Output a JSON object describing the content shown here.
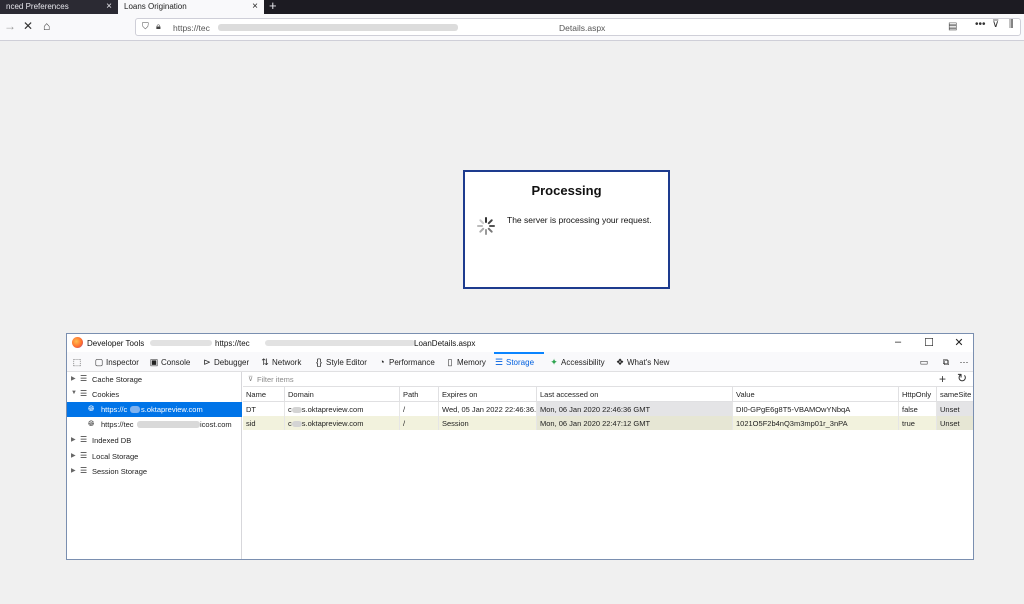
{
  "browser": {
    "tabs": [
      {
        "label": "nced Preferences"
      },
      {
        "label": "Loans Origination"
      }
    ],
    "url_prefix": "https://tec",
    "url_suffix": "Details.aspx"
  },
  "dialog": {
    "title": "Processing",
    "message": "The server is processing your request."
  },
  "devtools": {
    "window_title": "Developer Tools",
    "url_prefix": "https://tec",
    "url_suffix": "LoanDetails.aspx",
    "tools": [
      {
        "label": "Inspector"
      },
      {
        "label": "Console"
      },
      {
        "label": "Debugger"
      },
      {
        "label": "Network"
      },
      {
        "label": "Style Editor"
      },
      {
        "label": "Performance"
      },
      {
        "label": "Memory"
      },
      {
        "label": "Storage"
      },
      {
        "label": "Accessibility"
      },
      {
        "label": "What's New"
      }
    ],
    "tree": [
      {
        "label": "Cache Storage"
      },
      {
        "label": "Cookies"
      },
      {
        "label_prefix": "https://c",
        "label_suffix": "s.oktapreview.com"
      },
      {
        "label_prefix": "https://tec",
        "label_suffix": "icost.com"
      },
      {
        "label": "Indexed DB"
      },
      {
        "label": "Local Storage"
      },
      {
        "label": "Session Storage"
      }
    ],
    "filter_placeholder": "Filter items",
    "columns": [
      "Name",
      "Domain",
      "Path",
      "Expires on",
      "Last accessed on",
      "Value",
      "HttpOnly",
      "sameSite"
    ],
    "rows": [
      {
        "name": "DT",
        "domain_prefix": "c",
        "domain_suffix": "s.oktapreview.com",
        "path": "/",
        "expires": "Wed, 05 Jan 2022 22:46:36...",
        "last_accessed": "Mon, 06 Jan 2020 22:46:36 GMT",
        "value": "DI0-GPgE6g8T5-VBAMOwYNbqA",
        "httponly": "false",
        "samesite": "Unset"
      },
      {
        "name": "sid",
        "domain_prefix": "c",
        "domain_suffix": "s.oktapreview.com",
        "path": "/",
        "expires": "Session",
        "last_accessed": "Mon, 06 Jan 2020 22:47:12 GMT",
        "value": "1021O5F2b4nQ3m3mp01r_3nPA",
        "httponly": "true",
        "samesite": "Unset"
      }
    ]
  }
}
